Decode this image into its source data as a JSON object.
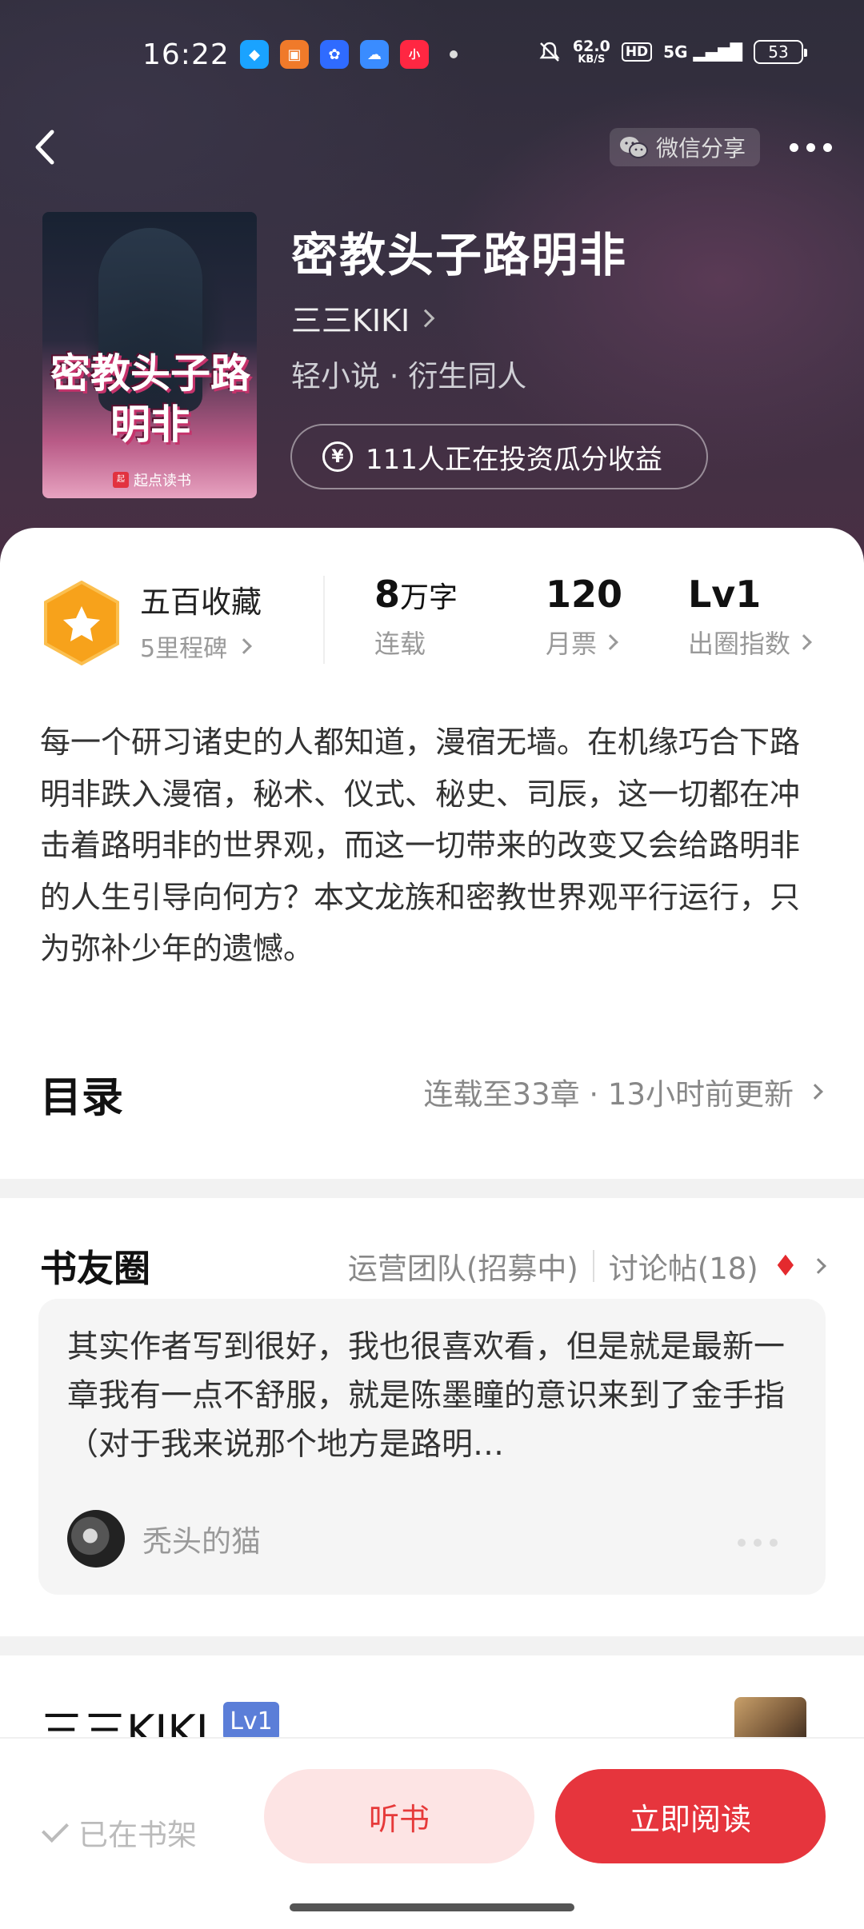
{
  "status_bar": {
    "time": "16:22",
    "apps": [
      {
        "icon": "qq-icon",
        "color": "#1aa3ff",
        "glyph": "◆"
      },
      {
        "icon": "book-app-icon",
        "color": "#f07a2a",
        "glyph": "▣"
      },
      {
        "icon": "baidu-icon",
        "color": "#2f6bff",
        "glyph": "✿"
      },
      {
        "icon": "weather-icon",
        "color": "#3a8cff",
        "glyph": "☁"
      },
      {
        "icon": "xiaohongshu-icon",
        "color": "#ff2742",
        "glyph": "小"
      }
    ],
    "net_speed": "62.0",
    "net_unit": "KB/S",
    "hd": "HD",
    "signal": "5G",
    "battery": "53"
  },
  "nav": {
    "share_label": "微信分享"
  },
  "book": {
    "title": "密教头子路明非",
    "cover_title": "密教头子路明非",
    "cover_brand": "起点读书",
    "author": "三三KIKI",
    "tags": "轻小说 · 衍生同人",
    "invest": "111人正在投资瓜分收益"
  },
  "stats": {
    "collect_title": "五百收藏",
    "collect_sub": "5里程碑",
    "words_num": "8",
    "words_unit": "万字",
    "words_label": "连载",
    "tickets": "120",
    "tickets_label": "月票",
    "level": "Lv1",
    "level_label": "出圈指数"
  },
  "synopsis": "每一个研习诸史的人都知道，漫宿无墙。在机缘巧合下路明非跌入漫宿，秘术、仪式、秘史、司辰，这一切都在冲击着路明非的世界观，而这一切带来的改变又会给路明非的人生引导向何方？本文龙族和密教世界观平行运行，只为弥补少年的遗憾。",
  "toc": {
    "title": "目录",
    "info": "连载至33章 · 13小时前更新"
  },
  "forum": {
    "title": "书友圈",
    "ops_team": "运营团队(招募中)",
    "posts": "讨论帖(18)",
    "post_text": "其实作者写到很好，我也很喜欢看，但是就是最新一章我有一点不舒服，就是陈墨瞳的意识来到了金手指（对于我来说那个地方是路明…",
    "post_user": "秃头的猫"
  },
  "author_section": {
    "name": "三三KIKI",
    "level": "Lv1"
  },
  "bottom": {
    "shelf": "已在书架",
    "listen": "听书",
    "read": "立即阅读"
  },
  "colors": {
    "accent": "#e6353d",
    "badge": "#f7a21b",
    "level_badge": "#5b7ed8"
  }
}
